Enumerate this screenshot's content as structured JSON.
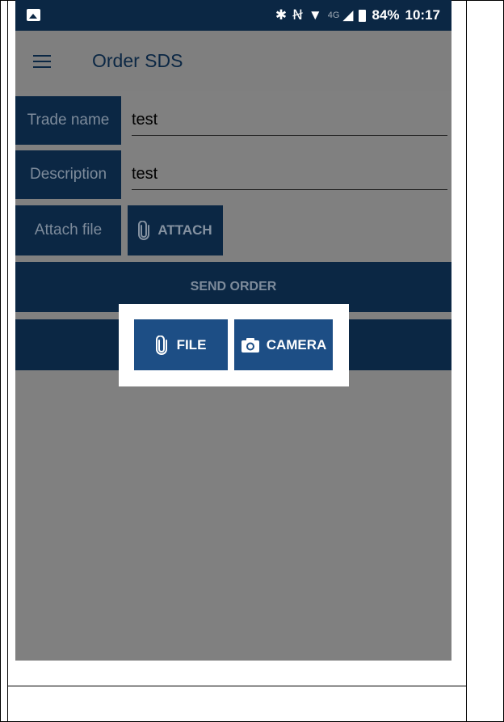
{
  "status_bar": {
    "bluetooth_icon": "bluetooth-icon",
    "nfc_icon": "nfc-icon",
    "wifi_icon": "wifi-icon",
    "network_label": "4G",
    "signal_icon": "signal-icon",
    "battery_percent": "84%",
    "time": "10:17"
  },
  "app_bar": {
    "menu_icon": "hamburger-icon",
    "title": "Order SDS"
  },
  "form": {
    "trade_name": {
      "label": "Trade name",
      "value": "test"
    },
    "description": {
      "label": "Description",
      "value": "test"
    },
    "attach_file": {
      "label": "Attach file",
      "button": "ATTACH",
      "icon": "paperclip-icon"
    }
  },
  "actions": {
    "send_order": "SEND ORDER"
  },
  "attach_popup": {
    "file_button": "FILE",
    "file_icon": "paperclip-icon",
    "camera_button": "CAMERA",
    "camera_icon": "camera-icon"
  },
  "colors": {
    "primary": "#0b2744",
    "button": "#1d4e85",
    "overlay": "#808080"
  }
}
